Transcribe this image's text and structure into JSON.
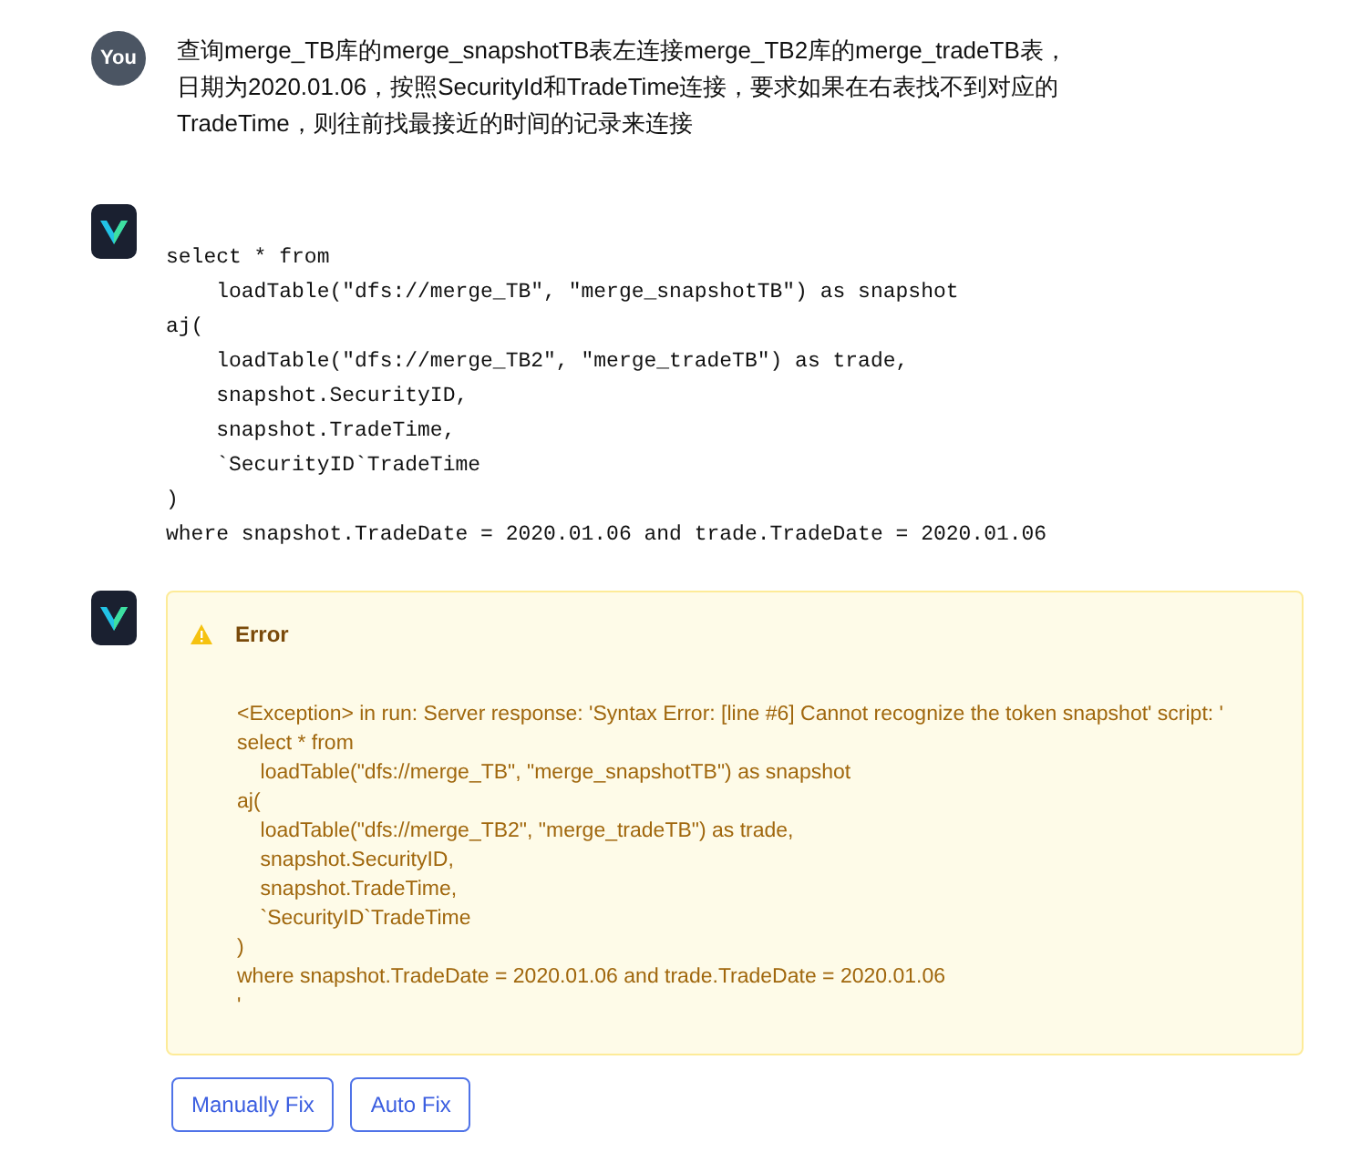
{
  "messages": [
    {
      "kind": "user",
      "avatar": "You",
      "text": "查询merge_TB库的merge_snapshotTB表左连接merge_TB2库的merge_tradeTB表，日期为2020.01.06，按照SecurityId和TradeTime连接，要求如果在右表找不到对应的TradeTime，则往前找最接近的时间的记录来连接"
    },
    {
      "kind": "code",
      "lines": [
        "select * from",
        "    loadTable(\"dfs://merge_TB\", \"merge_snapshotTB\") as snapshot",
        "aj(",
        "    loadTable(\"dfs://merge_TB2\", \"merge_tradeTB\") as trade,",
        "    snapshot.SecurityID,",
        "    snapshot.TradeTime,",
        "    `SecurityID`TradeTime",
        ")",
        "where snapshot.TradeDate = 2020.01.06 and trade.TradeDate = 2020.01.06"
      ]
    },
    {
      "kind": "error",
      "title": "Error",
      "lines": [
        "<Exception> in run: Server response: 'Syntax Error: [line #6] Cannot recognize the token snapshot' script: '",
        "select * from",
        "    loadTable(\"dfs://merge_TB\", \"merge_snapshotTB\") as snapshot",
        "aj(",
        "    loadTable(\"dfs://merge_TB2\", \"merge_tradeTB\") as trade,",
        "    snapshot.SecurityID,",
        "    snapshot.TradeTime,",
        "    `SecurityID`TradeTime",
        ")",
        "where snapshot.TradeDate = 2020.01.06 and trade.TradeDate = 2020.01.06",
        "'"
      ],
      "buttons": [
        "Manually Fix",
        "Auto Fix"
      ]
    }
  ]
}
